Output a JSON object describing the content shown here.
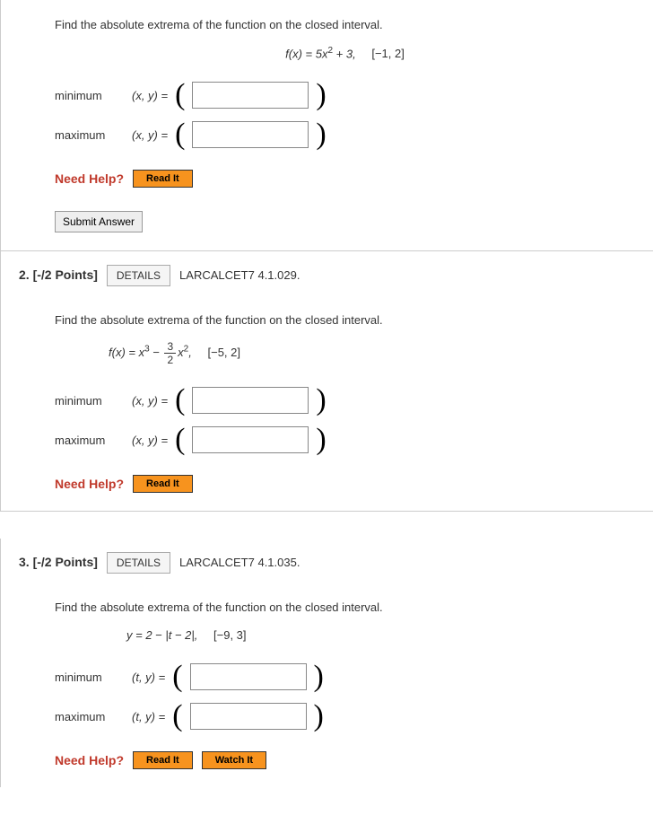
{
  "q1": {
    "prompt": "Find the absolute extrema of the function on the closed interval.",
    "formula_prefix": "f(x) = 5x",
    "formula_exp": "2",
    "formula_suffix": " + 3,",
    "interval": "[−1, 2]",
    "min_label": "minimum",
    "max_label": "maximum",
    "pair_label_min": "(x, y)  =",
    "pair_label_max": "(x, y)  =",
    "need_help": "Need Help?",
    "read_it": "Read It",
    "submit": "Submit Answer"
  },
  "q2": {
    "number": "2.",
    "points": "[-/2 Points]",
    "details": "DETAILS",
    "source": "LARCALCET7 4.1.029.",
    "prompt": "Find the absolute extrema of the function on the closed interval.",
    "formula_prefix": "f(x) = x",
    "formula_exp1": "3",
    "formula_mid": " − ",
    "frac_num": "3",
    "frac_den": "2",
    "formula_x": "x",
    "formula_exp2": "2",
    "formula_suffix": ",",
    "interval": "[−5, 2]",
    "min_label": "minimum",
    "max_label": "maximum",
    "pair_label_min": "(x, y)  =",
    "pair_label_max": "(x, y)  =",
    "need_help": "Need Help?",
    "read_it": "Read It"
  },
  "q3": {
    "number": "3.",
    "points": "[-/2 Points]",
    "details": "DETAILS",
    "source": "LARCALCET7 4.1.035.",
    "prompt": "Find the absolute extrema of the function on the closed interval.",
    "formula": "y = 2 − |t − 2|,",
    "interval": "[−9, 3]",
    "min_label": "minimum",
    "max_label": "maximum",
    "pair_label_min": "(t, y)  =",
    "pair_label_max": "(t, y)  =",
    "need_help": "Need Help?",
    "read_it": "Read It",
    "watch_it": "Watch It"
  }
}
